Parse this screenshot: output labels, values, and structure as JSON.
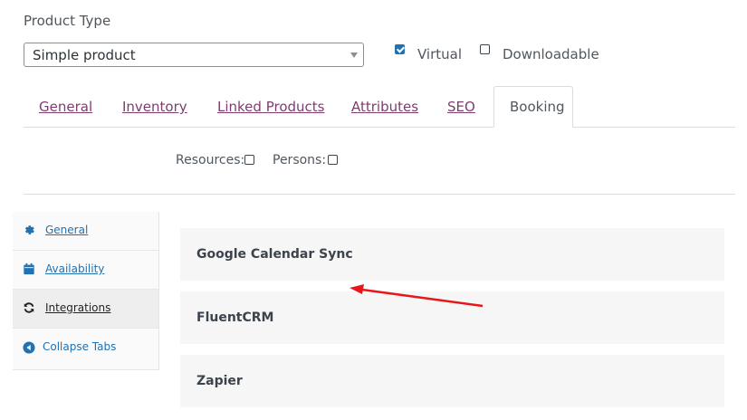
{
  "product_type": {
    "label": "Product Type",
    "selected": "Simple product"
  },
  "options": {
    "virtual": {
      "label": "Virtual",
      "checked": true
    },
    "downloadable": {
      "label": "Downloadable",
      "checked": false
    }
  },
  "tabs": [
    {
      "label": "General"
    },
    {
      "label": "Inventory"
    },
    {
      "label": "Linked Products"
    },
    {
      "label": "Attributes"
    },
    {
      "label": "SEO"
    },
    {
      "label": "Booking",
      "active": true
    }
  ],
  "booking_options": {
    "resources_label": "Resources:",
    "persons_label": "Persons:"
  },
  "sidebar": {
    "items": [
      {
        "label": "General",
        "icon": "gear-icon"
      },
      {
        "label": "Availability",
        "icon": "calendar-icon"
      },
      {
        "label": "Integrations",
        "icon": "sync-icon",
        "active": true
      },
      {
        "label": "Collapse Tabs",
        "icon": "collapse-left-icon"
      }
    ]
  },
  "integrations": [
    {
      "title": "Google Calendar Sync"
    },
    {
      "title": "FluentCRM"
    },
    {
      "title": "Zapier"
    }
  ],
  "colors": {
    "accent": "#2271b1",
    "tab_link": "#7f3c6e",
    "arrow": "#e8161b"
  }
}
